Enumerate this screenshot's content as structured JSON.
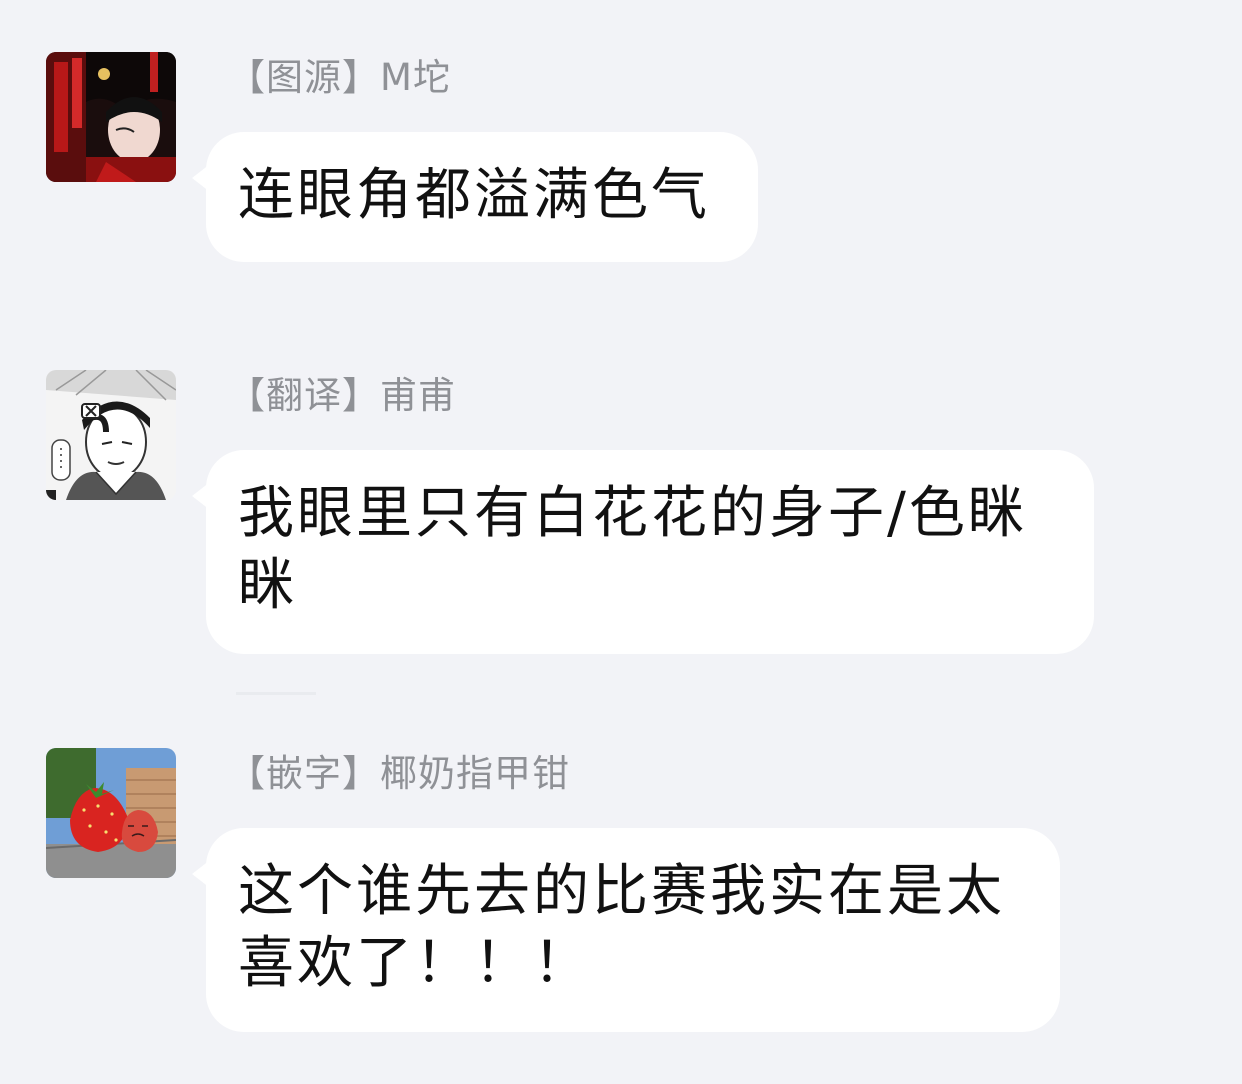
{
  "messages": [
    {
      "sender": "【图源】M坨",
      "text": "连眼角都溢满色气",
      "avatar_icon": "avatar-red-robed-character-icon"
    },
    {
      "sender": "【翻译】甫甫",
      "text": "我眼里只有白花花的身子/色眯眯",
      "avatar_icon": "avatar-manga-character-icon"
    },
    {
      "sender": "【嵌字】椰奶指甲钳",
      "text": "这个谁先去的比赛我实在是太喜欢了！！！",
      "avatar_icon": "avatar-strawberries-icon"
    }
  ],
  "colors": {
    "background": "#f2f3f7",
    "bubble": "#ffffff",
    "sender_text": "#8f9196",
    "message_text": "#111111"
  }
}
